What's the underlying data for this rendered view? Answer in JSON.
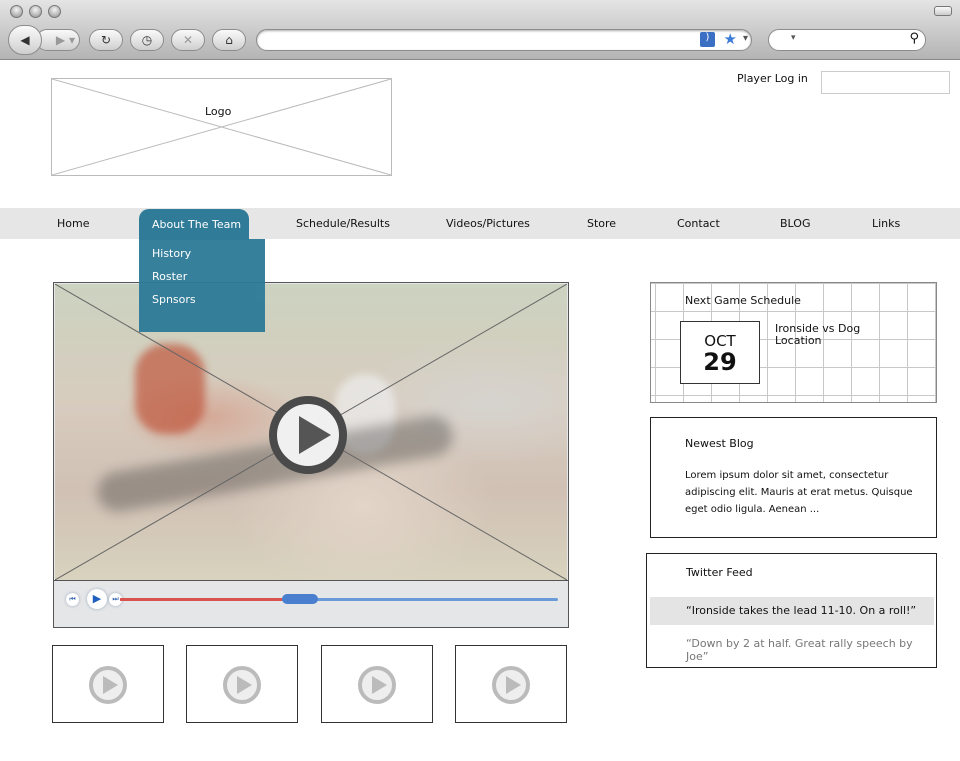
{
  "browser": {
    "icons": [
      "back-icon",
      "forward-icon",
      "reload-icon",
      "history-icon",
      "stop-icon",
      "home-icon",
      "rss-icon",
      "bookmark-star-icon",
      "search-icon"
    ],
    "url": "",
    "search": ""
  },
  "header": {
    "logo": "Logo",
    "login_label": "Player Log in"
  },
  "nav": {
    "items": [
      "Home",
      "About The Team",
      "Schedule/Results",
      "Videos/Pictures",
      "Store",
      "Contact",
      "BLOG",
      "Links"
    ],
    "submenu": [
      "History",
      "Roster",
      "Spnsors"
    ]
  },
  "video": {
    "progress": 0.37,
    "colors": {
      "played": "#d9534f",
      "remaining": "#6b9ad8"
    }
  },
  "schedule": {
    "title": "Next Game Schedule",
    "month": "OCT",
    "day": "29",
    "matchup": "Ironside vs Dog",
    "location": "Location"
  },
  "blog": {
    "title": "Newest Blog",
    "text": "Lorem ipsum dolor sit amet, consectetur adipiscing elit. Mauris at erat metus. Quisque eget odio ligula. Aenean ..."
  },
  "twitter": {
    "title": "Twitter Feed",
    "tweets": [
      "“Ironside takes the lead 11-10. On a roll!”",
      "“Down by 2 at half. Great rally speech by Joe”"
    ]
  },
  "accent": "#2f7b98"
}
